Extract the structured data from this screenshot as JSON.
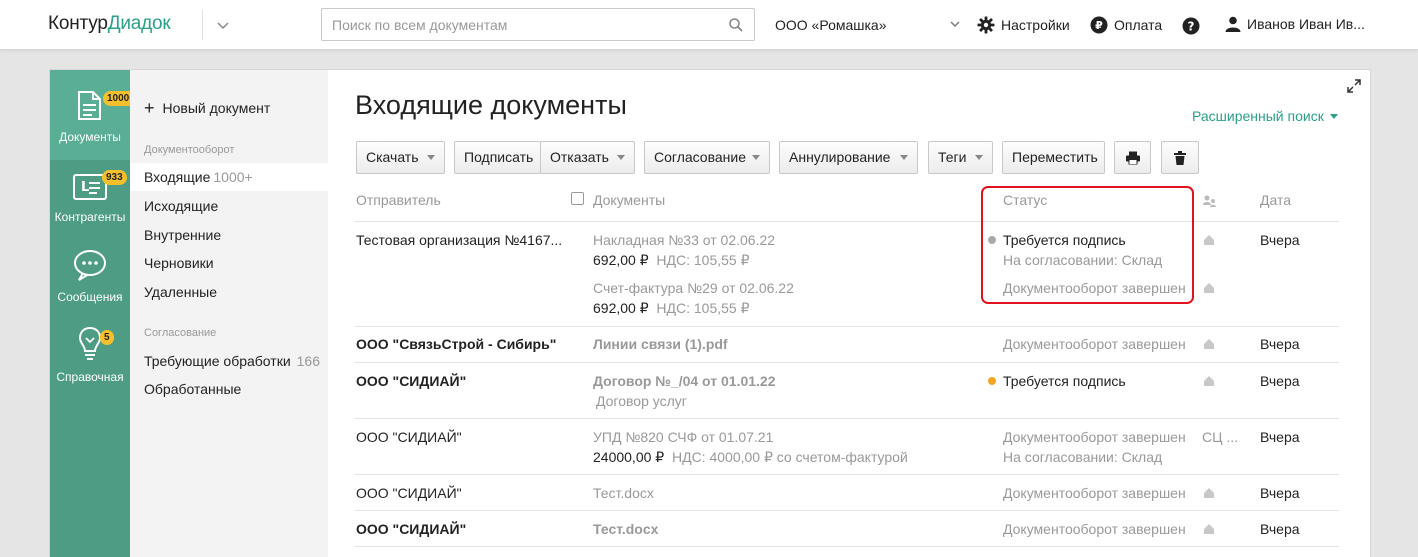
{
  "header": {
    "logo_part1": "Контур",
    "logo_part2": "Диадок",
    "search_placeholder": "Поиск по всем документам",
    "organization": "ООО «Ромашка»",
    "settings": "Настройки",
    "payment": "Оплата",
    "user": "Иванов Иван Ив..."
  },
  "leftnav": {
    "items": [
      {
        "label": "Документы",
        "badge": "1000+",
        "icon": "document-icon"
      },
      {
        "label": "Контрагенты",
        "badge": "933",
        "icon": "contact-card-icon"
      },
      {
        "label": "Сообщения",
        "badge": "",
        "icon": "chat-bubble-icon"
      },
      {
        "label": "Справочная",
        "badge": "5",
        "icon": "lightbulb-icon"
      }
    ]
  },
  "sidenav": {
    "new_document": "Новый документ",
    "section1": "Документооборот",
    "items1": [
      {
        "label": "Входящие",
        "count": "1000+"
      },
      {
        "label": "Исходящие",
        "count": ""
      },
      {
        "label": "Внутренние",
        "count": ""
      },
      {
        "label": "Черновики",
        "count": ""
      },
      {
        "label": "Удаленные",
        "count": ""
      }
    ],
    "section2": "Согласование",
    "items2": [
      {
        "label": "Требующие обработки",
        "count": "166"
      },
      {
        "label": "Обработанные",
        "count": ""
      }
    ]
  },
  "main": {
    "title": "Входящие документы",
    "advanced_search": "Расширенный поиск",
    "toolbar": {
      "download": "Скачать",
      "sign": "Подписать",
      "reject": "Отказать",
      "approval": "Согласование",
      "annul": "Аннулирование",
      "tags": "Теги",
      "move": "Переместить"
    },
    "columns": {
      "sender": "Отправитель",
      "documents": "Документы",
      "status": "Статус",
      "date": "Дата"
    },
    "rows": [
      {
        "sender": "Тестовая организация №4167...",
        "doc1": "Накладная №33 от 02.06.22",
        "doc1_sum": "692,00 ₽",
        "doc1_vat": "НДС: 105,55 ₽",
        "doc2": "Счет-фактура №29 от 02.06.22",
        "doc2_sum": "692,00 ₽",
        "doc2_vat": "НДС: 105,55 ₽",
        "status1": "Требуется подпись",
        "status1b": "На согласовании: Склад",
        "status2": "Документооборот завершен",
        "date": "Вчера"
      },
      {
        "sender": "ООО \"СвязьСтрой - Сибирь\"",
        "doc": "Линии связи (1).pdf",
        "status": "Документооборот завершен",
        "date": "Вчера"
      },
      {
        "sender": "ООО \"СИДИАЙ\"",
        "doc": "Договор №_/04 от 01.01.22",
        "doc_sub": "Договор услуг",
        "status": "Требуется подпись",
        "date": "Вчера"
      },
      {
        "sender": "ООО \"СИДИАЙ\"",
        "doc": "УПД №820 СЧФ от 01.07.21",
        "doc_sum": "24000,00 ₽",
        "doc_vat": "НДС: 4000,00 ₽  со счетом-фактурой",
        "status": "Документооборот завершен",
        "status_b": "На согласовании: Склад",
        "tag": "СЦ ...",
        "date": "Вчера"
      },
      {
        "sender": "ООО \"СИДИАЙ\"",
        "doc": "Тест.docx",
        "status": "Документооборот завершен",
        "date": "Вчера"
      },
      {
        "sender": "ООО \"СИДИАЙ\"",
        "doc": "Тест.docx",
        "status": "Документооборот завершен",
        "date": "Вчера"
      }
    ]
  },
  "colors": {
    "accent": "#2aa089",
    "nav_bg": "#4e9c84",
    "badge": "#f5c02a",
    "highlight": "#e0121e",
    "status_orange": "#f5a623"
  }
}
